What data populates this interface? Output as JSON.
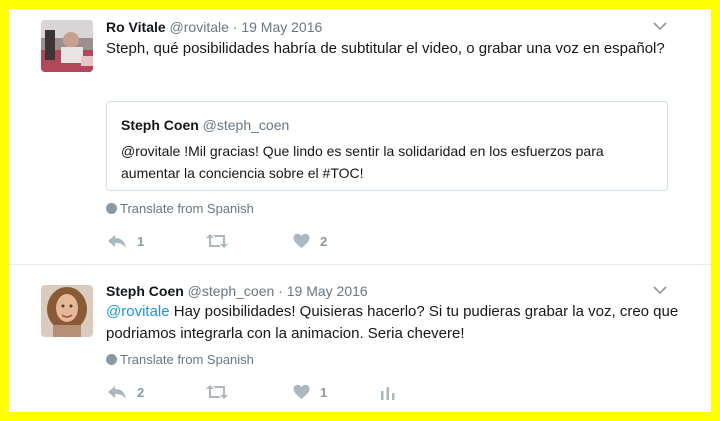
{
  "tweets": [
    {
      "author": {
        "name": "Ro Vitale",
        "handle": "@rovitale"
      },
      "separator": "·",
      "date": "19 May 2016",
      "text": "Steph, qué posibilidades habría de subtitular el video, o grabar una voz en español?",
      "quote": {
        "author": {
          "name": "Steph Coen",
          "handle": "@steph_coen"
        },
        "text": "@rovitale !Mil gracias! Que lindo es sentir la solidaridad en los esfuerzos para aumentar la conciencia sobre el #TOC!"
      },
      "translate_label": "Translate from Spanish",
      "actions": {
        "reply_count": "1",
        "retweet_count": "",
        "like_count": "2"
      }
    },
    {
      "author": {
        "name": "Steph Coen",
        "handle": "@steph_coen"
      },
      "separator": "·",
      "date": "19 May 2016",
      "mention": "@rovitale",
      "text": " Hay posibilidades! Quisieras hacerlo? Si tu pudieras grabar la voz, creo que podriamos integrarla con la animacion. Seria chevere!",
      "translate_label": "Translate from Spanish",
      "actions": {
        "reply_count": "2",
        "retweet_count": "",
        "like_count": "1"
      }
    }
  ],
  "icons": {
    "reply": "reply-icon",
    "retweet": "retweet-icon",
    "like": "heart-icon",
    "analytics": "analytics-icon",
    "translate": "globe-icon",
    "more": "chevron-down-icon"
  },
  "colors": {
    "border_highlight": "#ffff00",
    "link": "#1b95e0",
    "text": "#14171a",
    "secondary": "#657786",
    "icon": "#aab8c2"
  }
}
